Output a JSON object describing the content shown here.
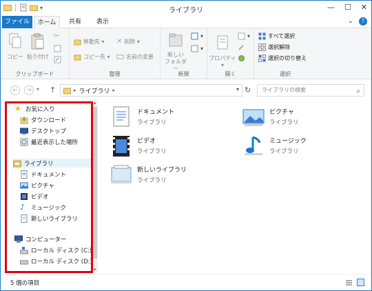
{
  "window": {
    "title": "ライブラリ"
  },
  "ribbon_tabs": {
    "file": "ファイル",
    "home": "ホーム",
    "share": "共有",
    "view": "表示"
  },
  "ribbon": {
    "clipboard": {
      "label": "クリップボード",
      "copy": "コピー",
      "paste": "貼り付け"
    },
    "organize": {
      "label": "整理",
      "move_to": "移動先 ▾",
      "copy_to": "コピー先 ▾",
      "delete": "削除 ▾",
      "rename": "名前の変更"
    },
    "new": {
      "label": "新規",
      "new_folder": "新しい\nフォルダー"
    },
    "open": {
      "label": "開く",
      "properties": "プロパティ ▾"
    },
    "select": {
      "label": "選択",
      "select_all": "すべて選択",
      "select_none": "選択解除",
      "invert": "選択の切り替え"
    }
  },
  "address": {
    "path": "ライブラリ",
    "search_placeholder": "ライブラリの検索"
  },
  "nav": {
    "favorites": "お気に入り",
    "downloads": "ダウンロード",
    "desktop": "デスクトップ",
    "recent": "最近表示した場所",
    "libraries": "ライブラリ",
    "documents": "ドキュメント",
    "pictures": "ピクチャ",
    "videos": "ビデオ",
    "music": "ミュージック",
    "new_library": "新しいライブラリ",
    "computer": "コンピューター",
    "disk_c": "ローカル ディスク (C:)",
    "disk_d": "ローカル ディスク (D:)"
  },
  "content": {
    "items": [
      {
        "name": "ドキュメント",
        "type": "ライブラリ",
        "icon": "documents-library-icon"
      },
      {
        "name": "ピクチャ",
        "type": "ライブラリ",
        "icon": "pictures-library-icon"
      },
      {
        "name": "ビデオ",
        "type": "ライブラリ",
        "icon": "videos-library-icon"
      },
      {
        "name": "ミュージック",
        "type": "ライブラリ",
        "icon": "music-library-icon"
      },
      {
        "name": "新しいライブラリ",
        "type": "ライブラリ",
        "icon": "new-library-icon"
      }
    ]
  },
  "status": {
    "count": "5 個の項目"
  },
  "colors": {
    "accent": "#1979ca",
    "highlight": "#e00010"
  }
}
